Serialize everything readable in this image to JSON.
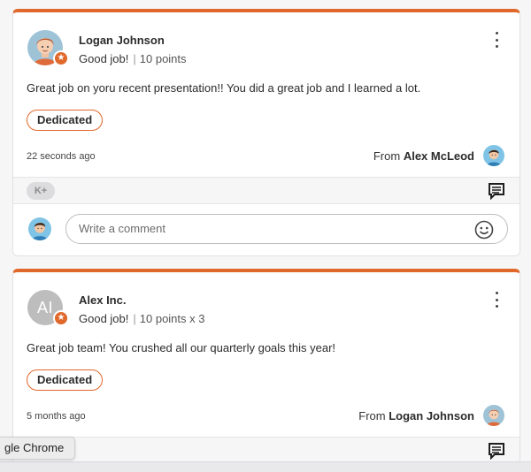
{
  "posts": [
    {
      "author_name": "Logan Johnson",
      "badge": "Good job!",
      "points": "10 points",
      "message": "Great job on yoru recent presentation!! You did a great job and I learned a lot.",
      "tag": "Dedicated",
      "timestamp": "22 seconds ago",
      "from_prefix": "From",
      "from_name": "Alex McLeod",
      "avatar_icon": "person-avatar-icon",
      "has_actions": true
    },
    {
      "author_name": "Alex Inc.",
      "author_initials": "AI",
      "badge": "Good job!",
      "points": "10 points x 3",
      "message": "Great job team! You crushed all our quarterly goals this year!",
      "tag": "Dedicated",
      "timestamp": "5 months ago",
      "from_prefix": "From",
      "from_name": "Logan Johnson"
    }
  ],
  "actions": {
    "reactions_label": "K+"
  },
  "comment": {
    "placeholder": "Write a comment"
  },
  "tooltip": {
    "text": "gle Chrome"
  },
  "colors": {
    "accent": "#e0682b",
    "card_border": "#e1e1e4",
    "background": "#f6f6f7"
  },
  "icons": {
    "kebab": "kebab-menu-icon",
    "star": "star-badge-icon",
    "comment": "comment-icon",
    "emoji": "emoji-icon"
  }
}
